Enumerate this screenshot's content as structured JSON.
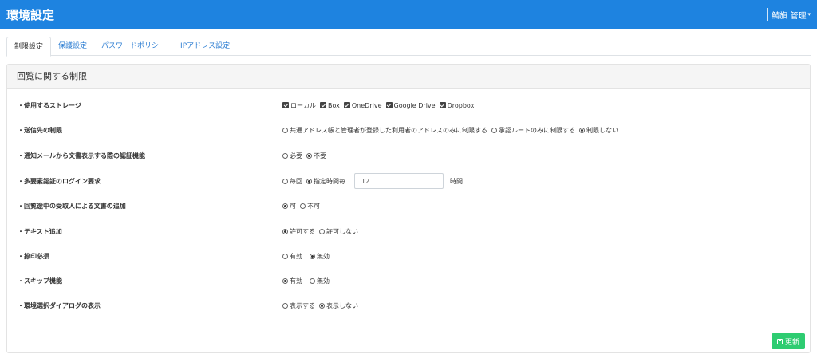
{
  "header": {
    "title": "環境設定",
    "user_name": "鯖旗 管理",
    "caret": "▾"
  },
  "tabs": [
    {
      "label": "制限設定",
      "active": true
    },
    {
      "label": "保護設定",
      "active": false
    },
    {
      "label": "パスワードポリシー",
      "active": false
    },
    {
      "label": "IPアドレス設定",
      "active": false
    }
  ],
  "card": {
    "title": "回覧に関する制限"
  },
  "settings": {
    "storage": {
      "label": "・使用するストレージ",
      "options": [
        "ローカル",
        "Box",
        "OneDrive",
        "Google Drive",
        "Dropbox"
      ],
      "checked": [
        true,
        true,
        true,
        true,
        true
      ]
    },
    "destination": {
      "label": "・送信先の制限",
      "options": [
        "共通アドレス帳と管理者が登録した利用者のアドレスのみに制限する",
        "承認ルートのみに制限する",
        "制限しない"
      ],
      "selected": 2
    },
    "mail_auth": {
      "label": "・通知メールから文書表示する際の認証機能",
      "options": [
        "必要",
        "不要"
      ],
      "selected": 1
    },
    "mfa": {
      "label": "・多要素認証のログイン要求",
      "options": [
        "毎回",
        "指定時間毎"
      ],
      "selected": 1,
      "hours_value": "12",
      "unit": "時間"
    },
    "add_doc": {
      "label": "・回覧途中の受取人による文書の追加",
      "options": [
        "可",
        "不可"
      ],
      "selected": 0
    },
    "text_add": {
      "label": "・テキスト追加",
      "options": [
        "許可する",
        "許可しない"
      ],
      "selected": 0
    },
    "stamp": {
      "label": "・捺印必須",
      "options": [
        "有効",
        "無効"
      ],
      "selected": 1
    },
    "skip": {
      "label": "・スキップ機能",
      "options": [
        "有効",
        "無効"
      ],
      "selected": 0
    },
    "env_dialog": {
      "label": "・環境選択ダイアログの表示",
      "options": [
        "表示する",
        "表示しない"
      ],
      "selected": 1
    }
  },
  "actions": {
    "update_label": "更新"
  },
  "colors": {
    "header_bg": "#1e83e0",
    "tab_link": "#2f7fd3",
    "update_button": "#2ecc71"
  }
}
